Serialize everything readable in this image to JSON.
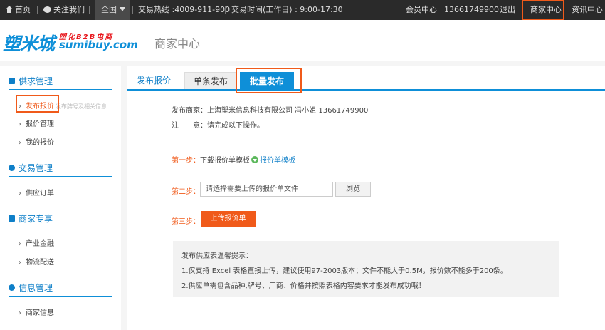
{
  "topbar": {
    "home": "首页",
    "follow": "关注我们",
    "region": "全国",
    "hotline": "交易热线 :4009-911-900",
    "hours": "交易时间(工作日) : 9:00-17:30",
    "member_center": "会员中心",
    "phone": "13661749900",
    "logout": "退出",
    "merchant_center": "商家中心",
    "news_center": "资讯中心"
  },
  "header": {
    "logo_cn": "塑米城",
    "logo_sub": "塑化B2B电商",
    "logo_en": "sumibuy.com",
    "title": "商家中心"
  },
  "sidebar": {
    "sections": [
      {
        "title": "供求管理",
        "icon": "document-icon"
      },
      {
        "title": "交易管理",
        "icon": "alarm-clock-icon"
      },
      {
        "title": "商家专享",
        "icon": "crown-icon"
      },
      {
        "title": "信息管理",
        "icon": "user-group-icon"
      }
    ],
    "items": {
      "publish_quote": "发布报价",
      "publish_hint": "发布牌号及相关信息",
      "quote_manage": "报价管理",
      "my_quotes": "我的报价",
      "supply_orders": "供应订单",
      "finance": "产业金融",
      "logistics": "物流配送",
      "merchant_info": "商家信息"
    }
  },
  "main": {
    "section_label": "发布报价",
    "tabs": [
      "单条发布",
      "批量发布"
    ],
    "active_tab": "批量发布",
    "merchant_line": "发布商家：上海塑米信息科技有限公司 冯小姐 13661749900",
    "note_line": "注　　意：请完成以下操作。",
    "step1_label": "第一步：",
    "step1_text": "下载报价单模板",
    "step1_link": "报价单模板",
    "step2_label": "第二步：",
    "file_placeholder": "请选择需要上传的报价单文件",
    "browse_label": "浏览",
    "step3_label": "第三步：",
    "upload_label": "上传报价单",
    "tips_title": "发布供应表温馨提示：",
    "tips": [
      "1.仅支持 Excel 表格直接上传，建议使用97-2003版本；文件不能大于0.5M，报价数不能多于200条。",
      "2.供应单需包含品种,牌号、厂商、价格并按照表格内容要求才能发布成功哦！"
    ]
  },
  "colors": {
    "accent": "#0e8fd8",
    "highlight": "#f05a1a",
    "topbar_bg": "#2a2a2a"
  }
}
